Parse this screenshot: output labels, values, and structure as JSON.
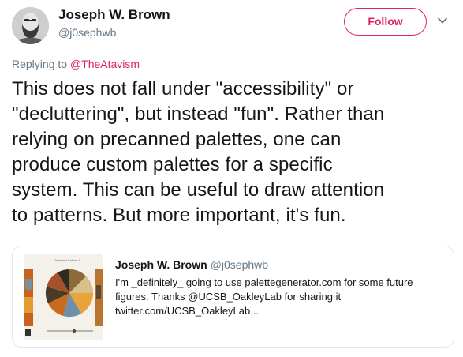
{
  "author": {
    "name": "Joseph W. Brown",
    "handle": "@j0sephwb"
  },
  "follow_button": {
    "label": "Follow"
  },
  "reply": {
    "prefix": "Replying to",
    "mention": "@TheAtavism"
  },
  "tweet": {
    "lines": [
      "This does not fall under \"accessibility\" or",
      "\"decluttering\", but instead \"fun\". Rather than",
      "relying on precanned palettes, one can",
      "produce custom palettes for a specific",
      "system. This can be useful to draw attention",
      "to patterns. But more important, it's fun."
    ]
  },
  "quote": {
    "name": "Joseph W. Brown",
    "handle": "@j0sephwb",
    "thumb_caption": "Dominant Colors: 9",
    "lines": [
      "I'm _definitely_ going to use palettegenerator.com for some future",
      "figures. Thanks @UCSB_OakleyLab for sharing it",
      "twitter.com/UCSB_OakleyLab..."
    ]
  },
  "colors": {
    "accent": "#e0245e",
    "secondary_text": "#657786",
    "border": "#e1e8ed"
  },
  "icons": {
    "more": "chevron-down-icon"
  }
}
